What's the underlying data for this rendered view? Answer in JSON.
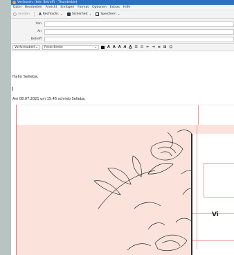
{
  "window": {
    "title": "Verfassen: (kein Betreff) - Thunderbird"
  },
  "menu": [
    "Datei",
    "Bearbeiten",
    "Ansicht",
    "Einfügen",
    "Format",
    "Optionen",
    "Extras",
    "Hilfe"
  ],
  "toolbar": {
    "send": "Senden",
    "spelling": "Rechtschr.",
    "security": "Sicherheit",
    "save": "Speichern"
  },
  "headers": {
    "from": "Von",
    "to": "An",
    "subject": "Betreff"
  },
  "format": {
    "paragraph": "Vorformatiert",
    "font": "Feste Breite"
  },
  "message": {
    "greeting": "Hallo Selieba,",
    "quote_header": "Am 08.07.2021 um 15:45 schrieb Selieba:",
    "quote_visible_text": "Vi"
  },
  "colors": {
    "title": "#2f6fc0",
    "quote_bg": "#fbe3dc",
    "quote_border": "#e07a7a"
  }
}
